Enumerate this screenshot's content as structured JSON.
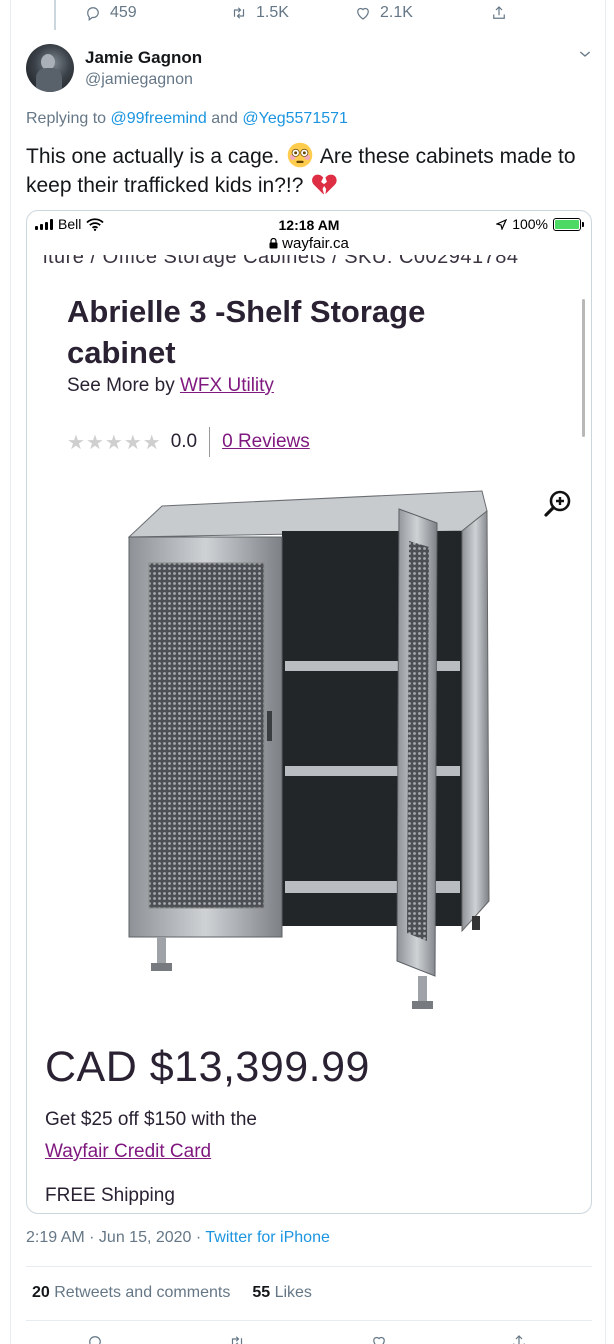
{
  "previous_tweet_actions": {
    "replies": "459",
    "retweets": "1.5K",
    "likes": "2.1K"
  },
  "author": {
    "display_name": "Jamie Gagnon",
    "handle": "@jamiegagnon"
  },
  "replying": {
    "prefix": "Replying to ",
    "mention1": "@99freemind",
    "and": " and ",
    "mention2": "@Yeg5571571"
  },
  "tweet": {
    "text_part1": "This one actually is a cage.",
    "emoji1": "flushed-face-emoji",
    "text_part2": "Are these cabinets made to keep their trafficked kids in?!?",
    "emoji2": "broken-heart-emoji"
  },
  "embedded_screenshot": {
    "status_bar": {
      "carrier": "Bell",
      "time": "12:18 AM",
      "battery": "100%"
    },
    "url": "wayfair.ca",
    "breadcrumb": "iture / Office Storage Cabinets / SKU: C002941784",
    "product_title": "Abrielle 3 -Shelf Storage cabinet",
    "see_more_prefix": "See More by ",
    "see_more_brand": "WFX Utility",
    "rating_value": "0.0",
    "reviews_link": "0 Reviews",
    "price": "CAD $13,399.99",
    "promo": "Get $25 off $150 with the",
    "credit_link": "Wayfair Credit Card",
    "shipping": "FREE Shipping"
  },
  "meta": {
    "time_date": "2:19 AM · Jun 15, 2020 · ",
    "source": "Twitter for iPhone"
  },
  "stats": {
    "retweets_count": "20",
    "retweets_label": "Retweets and comments",
    "likes_count": "55",
    "likes_label": "Likes"
  },
  "colors": {
    "twitter_blue": "#1b95e0",
    "secondary_text": "#657786",
    "wayfair_purple": "#7f187f"
  }
}
